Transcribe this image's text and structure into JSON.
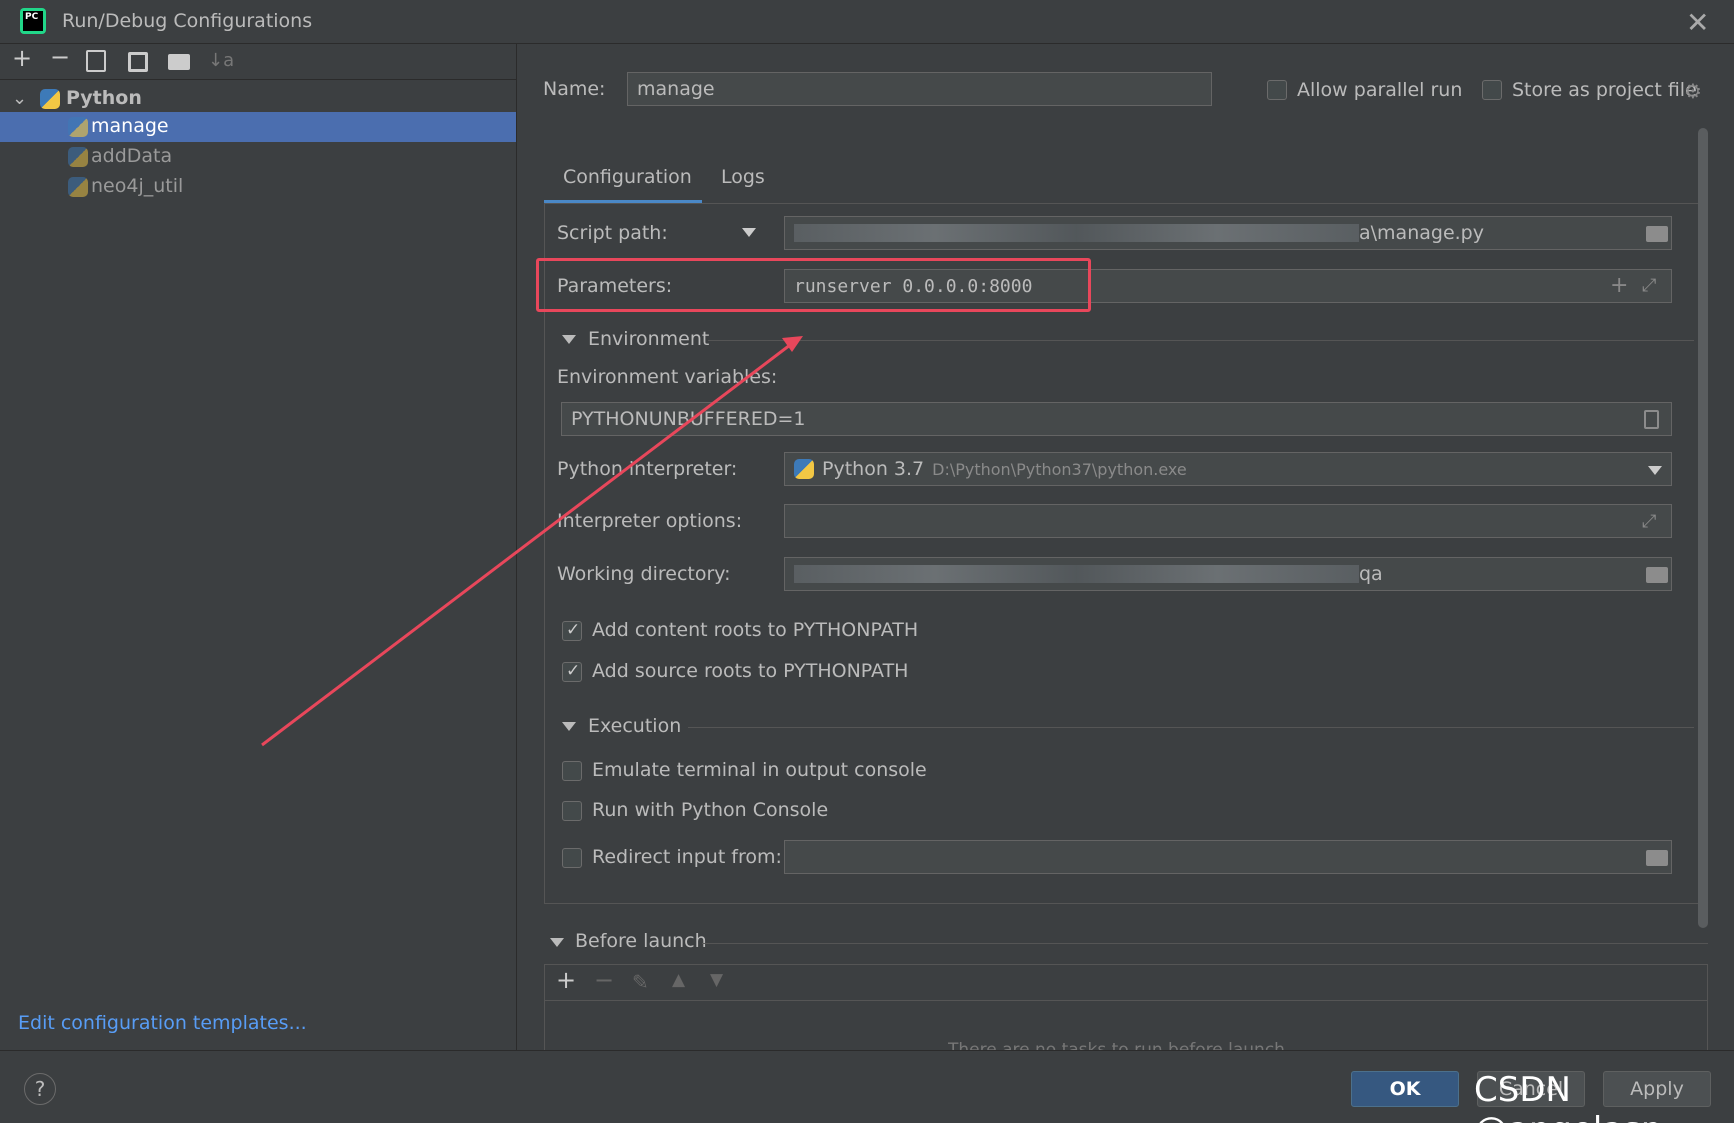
{
  "window": {
    "title": "Run/Debug Configurations",
    "app_icon_text": "PC"
  },
  "tree": {
    "group_label": "Python",
    "items": [
      {
        "label": "manage",
        "selected": true
      },
      {
        "label": "addData",
        "selected": false
      },
      {
        "label": "neo4j_util",
        "selected": false
      }
    ],
    "edit_templates_link": "Edit configuration templates..."
  },
  "header": {
    "name_label": "Name:",
    "name_value": "manage",
    "allow_parallel_label": "Allow parallel run",
    "store_project_label": "Store as project file"
  },
  "tabs": [
    {
      "label": "Configuration",
      "active": true
    },
    {
      "label": "Logs",
      "active": false
    }
  ],
  "config": {
    "script_path_label": "Script path:",
    "script_path_suffix": "a\\manage.py",
    "parameters_label": "Parameters:",
    "parameters_value": "runserver 0.0.0.0:8000",
    "environment_section": "Environment",
    "env_vars_label": "Environment variables:",
    "env_vars_value": "PYTHONUNBUFFERED=1",
    "interpreter_label": "Python interpreter:",
    "interpreter_name": "Python 3.7",
    "interpreter_path": "D:\\Python\\Python37\\python.exe",
    "interpreter_options_label": "Interpreter options:",
    "working_dir_label": "Working directory:",
    "working_dir_suffix": "qa",
    "add_content_roots": "Add content roots to PYTHONPATH",
    "add_source_roots": "Add source roots to PYTHONPATH",
    "execution_section": "Execution",
    "emulate_terminal": "Emulate terminal in output console",
    "run_python_console": "Run with Python Console",
    "redirect_input": "Redirect input from:",
    "before_launch_section": "Before launch",
    "no_tasks_text": "There are no tasks to run before launch"
  },
  "buttons": {
    "ok": "OK",
    "cancel": "Cancel",
    "apply": "Apply",
    "help": "?"
  },
  "watermark": "CSDN @angelasp",
  "colors": {
    "accent": "#4b6eaf",
    "highlight_box": "#e8475b",
    "arrow": "#e8475b",
    "link": "#589df6"
  }
}
